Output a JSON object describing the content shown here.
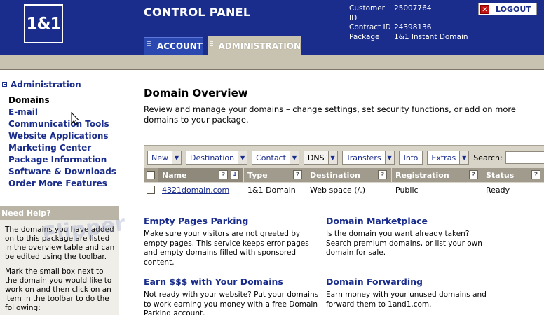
{
  "header": {
    "logo_text": "1&1",
    "title": "CONTROL PANEL",
    "account": [
      {
        "label": "Customer ID",
        "value": "25007764"
      },
      {
        "label": "Contract ID",
        "value": "24398136"
      },
      {
        "label": "Package",
        "value": "1&1 Instant Domain"
      }
    ],
    "logout_label": "LOGOUT",
    "tabs": [
      {
        "label": "ACCOUNT",
        "active": false
      },
      {
        "label": "ADMINISTRATION",
        "active": true
      }
    ]
  },
  "sidebar": {
    "heading": "Administration",
    "items": [
      {
        "label": "Domains",
        "active": true
      },
      {
        "label": "E-mail"
      },
      {
        "label": "Communication Tools"
      },
      {
        "label": "Website Applications"
      },
      {
        "label": "Marketing Center"
      },
      {
        "label": "Package Information"
      },
      {
        "label": "Software & Downloads"
      },
      {
        "label": "Order More Features"
      }
    ],
    "help": {
      "heading": "Need Help?",
      "paragraphs": [
        "The domains you have added on to this package are listed in the overview table and can be edited using the toolbar.",
        "Mark the small box next to the domain you would like to work on and then click on an item in the toolbar to do the following:"
      ]
    },
    "watermark": "Flipper"
  },
  "main": {
    "title": "Domain Overview",
    "description": "Review and manage your domains – change settings, set security functions, or add on more domains to your package.",
    "toolbar": {
      "buttons": [
        {
          "label": "New",
          "dropdown": true
        },
        {
          "label": "Destination",
          "dropdown": true
        },
        {
          "label": "Contact",
          "dropdown": true
        },
        {
          "label": "DNS",
          "dropdown": true
        },
        {
          "label": "Transfers",
          "dropdown": true
        },
        {
          "label": "Info",
          "dropdown": false
        },
        {
          "label": "Extras",
          "dropdown": true
        }
      ],
      "search_label": "Search:",
      "search_value": ""
    },
    "table": {
      "columns": [
        "Name",
        "Type",
        "Destination",
        "Registration",
        "Status"
      ],
      "help_glyph": "?",
      "sort_glyph": "↓",
      "rows": [
        {
          "name": "4321domain.com",
          "type": "1&1 Domain",
          "destination": "Web space (/.)",
          "registration": "Public",
          "status": "Ready"
        }
      ]
    },
    "features": [
      {
        "title": "Empty Pages Parking",
        "text": "Make sure your visitors are not greeted by empty pages. This service keeps error pages and empty domains filled with sponsored content."
      },
      {
        "title": "Domain Marketplace",
        "text": "Is the domain you want already taken? Search premium domains, or list your own domain for sale."
      },
      {
        "title": "Earn $$$ with Your Domains",
        "text": "Not ready with your website? Put your domains to work earning you money with a free Domain Parking account."
      },
      {
        "title": "Domain Forwarding",
        "text": "Earn money with your unused domains and forward them to 1and1.com."
      }
    ]
  },
  "colors": {
    "brand_blue": "#1a2d8c",
    "tab_tan": "#c8c2b0",
    "table_header": "#a19b8d"
  }
}
